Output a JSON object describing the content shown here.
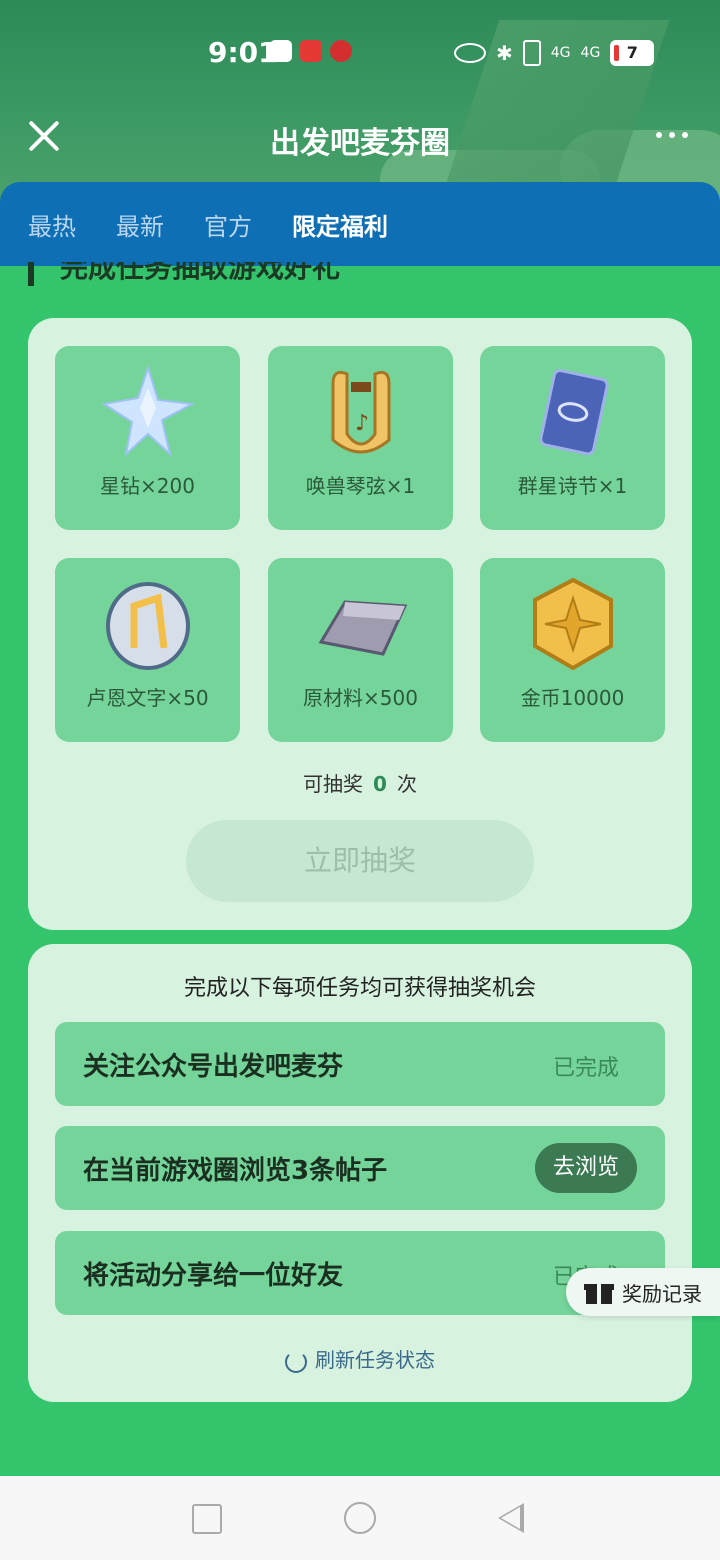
{
  "status_bar": {
    "time": "9:01",
    "battery": "7",
    "network": "4G"
  },
  "titlebar": {
    "title": "出发吧麦芬圈"
  },
  "tabs": [
    {
      "label": "最热"
    },
    {
      "label": "最新"
    },
    {
      "label": "官方"
    },
    {
      "label": "限定福利",
      "active": true
    }
  ],
  "section": {
    "title": "完成任务抽取游戏好礼"
  },
  "prizes": [
    {
      "label": "星钻×200",
      "icon": "star-crystal-icon"
    },
    {
      "label": "唤兽琴弦×1",
      "icon": "lyre-icon"
    },
    {
      "label": "群星诗节×1",
      "icon": "card-icon"
    },
    {
      "label": "卢恩文字×50",
      "icon": "rune-stone-icon"
    },
    {
      "label": "原材料×500",
      "icon": "ingot-icon"
    },
    {
      "label": "金币10000",
      "icon": "gold-coin-icon"
    }
  ],
  "draw": {
    "prefix": "可抽奖",
    "count": "0",
    "suffix": "次",
    "button_label": "立即抽奖"
  },
  "tasks": {
    "header": "完成以下每项任务均可获得抽奖机会",
    "items": [
      {
        "name": "关注公众号出发吧麦芬",
        "status": "已完成"
      },
      {
        "name": "在当前游戏圈浏览3条帖子",
        "action": "去浏览"
      },
      {
        "name": "将活动分享给一位好友",
        "status": "已完成"
      }
    ],
    "refresh_label": "刷新任务状态"
  },
  "float_button": {
    "label": "奖励记录"
  },
  "colors": {
    "background": "#33c46c",
    "tabbar": "#0f6fb5",
    "card": "#d8f2e0",
    "tile": "#74d49a"
  }
}
